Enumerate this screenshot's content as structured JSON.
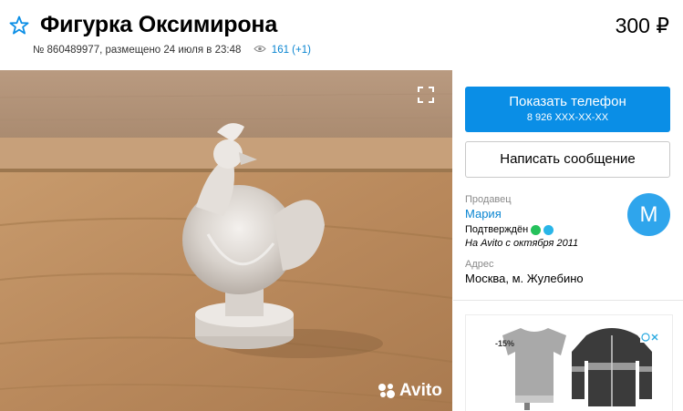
{
  "listing": {
    "title": "Фигурка Оксимирона",
    "price": "300 ₽",
    "meta_text": "№ 860489977, размещено 24 июля в 23:48",
    "views": "161 (+1)"
  },
  "photo": {
    "watermark": "Avito"
  },
  "actions": {
    "phone_button_label": "Показать телефон",
    "phone_number": "8 926 XXX-XX-XX",
    "message_button_label": "Написать сообщение"
  },
  "seller": {
    "section_label": "Продавец",
    "name": "Мария",
    "verified_label": "Подтверждён",
    "since": "На Avito с октября 2011",
    "avatar_letter": "М"
  },
  "address": {
    "section_label": "Адрес",
    "value": "Москва, м. Жулебино"
  },
  "ad": {
    "discount_badge": "-15%"
  },
  "colors": {
    "accent": "#0a8ee6",
    "link": "#0a85d1",
    "avatar": "#2fa5ec",
    "whatsapp": "#25c15b",
    "viber": "#29b5e8"
  }
}
